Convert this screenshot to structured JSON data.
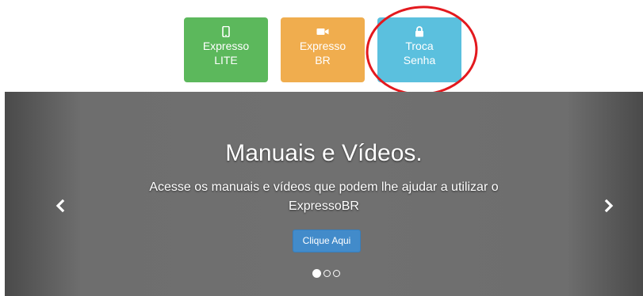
{
  "tiles": [
    {
      "label": "Expresso\nLITE",
      "icon": "mobile-phone-icon",
      "color": "#5cb85c"
    },
    {
      "label": "Expresso\nBR",
      "icon": "video-camera-icon",
      "color": "#f0ad4e"
    },
    {
      "label": "Troca\nSenha",
      "icon": "lock-icon",
      "color": "#5bc0de"
    }
  ],
  "highlight": {
    "color": "#e3191e"
  },
  "carousel": {
    "title": "Manuais e Vídeos.",
    "text": "Acesse os manuais e vídeos que podem lhe ajudar a utilizar o ExpressoBR",
    "button_label": "Clique Aqui",
    "prev_icon": "chevron-left-icon",
    "next_icon": "chevron-right-icon",
    "slide_count": 3,
    "active_slide": 1
  }
}
